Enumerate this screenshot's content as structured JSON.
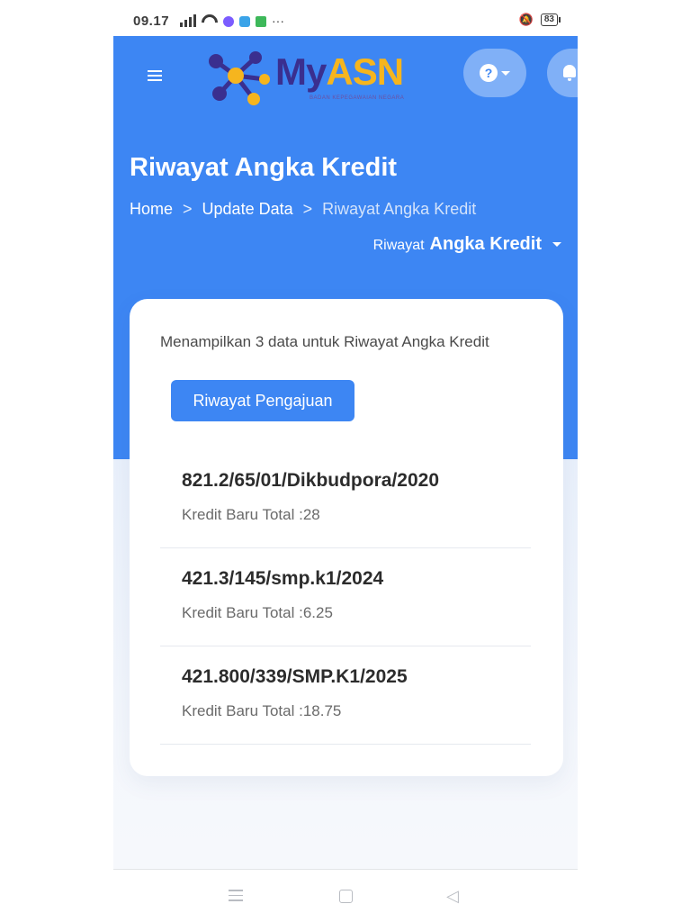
{
  "status_bar": {
    "time": "09.17",
    "battery": "83"
  },
  "header": {
    "logo": {
      "my": "My",
      "asn": "ASN",
      "subtitle": "BADAN KEPEGAWAIAN NEGARA"
    },
    "help_glyph": "?"
  },
  "page": {
    "title": "Riwayat Angka Kredit",
    "breadcrumb": [
      "Home",
      "Update Data",
      "Riwayat Angka Kredit"
    ],
    "breadcrumb_separator": ">",
    "dropdown": {
      "label_normal": "Riwayat",
      "label_bold": "Angka Kredit"
    }
  },
  "card": {
    "summary": "Menampilkan 3 data untuk Riwayat Angka Kredit",
    "button_label": "Riwayat Pengajuan",
    "records": [
      {
        "number": "821.2/65/01/Dikbudpora/2020",
        "detail": "Kredit Baru Total :28"
      },
      {
        "number": "421.3/145/smp.k1/2024",
        "detail": "Kredit Baru Total :6.25"
      },
      {
        "number": "421.800/339/SMP.K1/2025",
        "detail": "Kredit Baru Total :18.75"
      }
    ]
  },
  "colors": {
    "primary": "#3d86f3",
    "logo_purple": "#3a2f8f",
    "logo_yellow": "#f6b51e"
  }
}
